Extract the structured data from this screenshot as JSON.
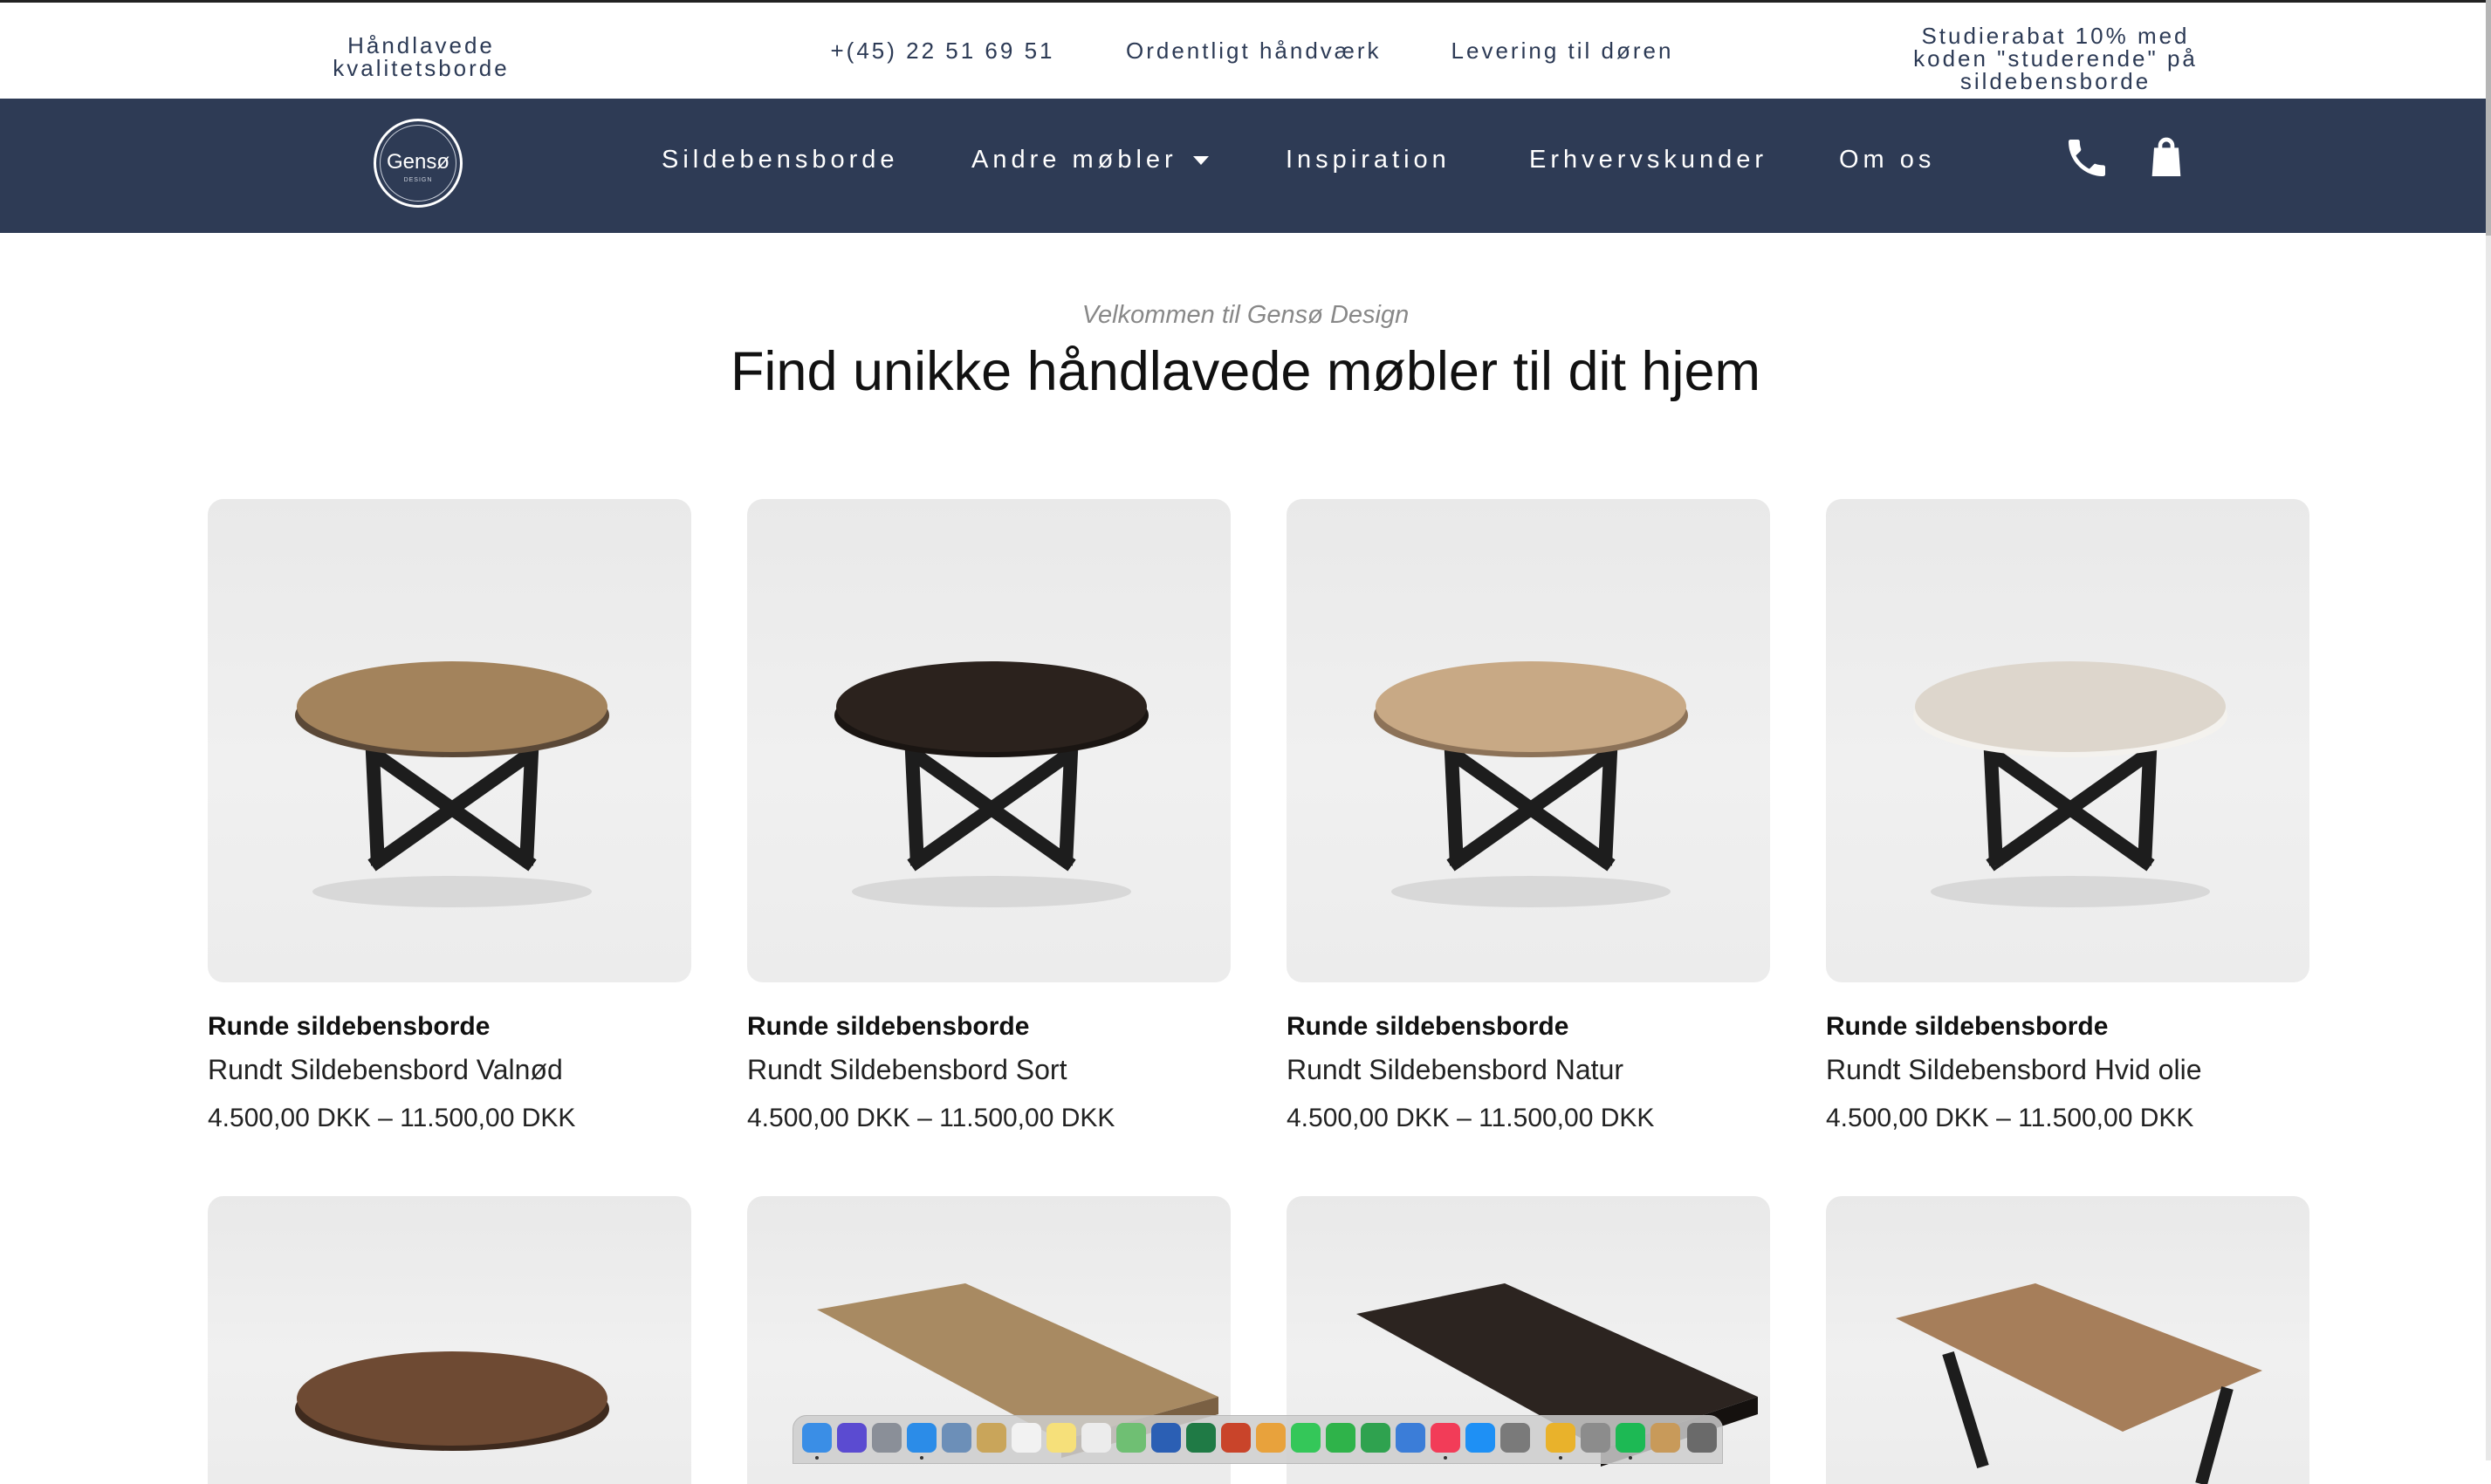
{
  "topbar": {
    "item1": "Håndlavede kvalitetsborde",
    "phone": "+(45) 22 51 69 51",
    "quality": "Ordentligt håndværk",
    "delivery": "Levering til døren",
    "student": "Studierabat 10% med koden \"studerende\" på sildebensborde"
  },
  "nav": {
    "logo_name": "Gensø",
    "logo_sub": "DESIGN",
    "items": [
      "Sildebensborde",
      "Andre møbler",
      "Inspiration",
      "Erhvervskunder",
      "Om os"
    ],
    "icons": [
      "phone-icon",
      "shopping-bag-icon"
    ]
  },
  "hero": {
    "eyebrow": "Velkommen til Gensø Design",
    "headline": "Find unikke håndlavede møbler til dit hjem"
  },
  "products": [
    {
      "category": "Runde sildebensborde",
      "title": "Rundt Sildebensbord Valnød",
      "price": "4.500,00 DKK – 11.500,00 DKK",
      "top_color": "#a3835c"
    },
    {
      "category": "Runde sildebensborde",
      "title": "Rundt Sildebensbord Sort",
      "price": "4.500,00 DKK – 11.500,00 DKK",
      "top_color": "#2b221d"
    },
    {
      "category": "Runde sildebensborde",
      "title": "Rundt Sildebensbord Natur",
      "price": "4.500,00 DKK – 11.500,00 DKK",
      "top_color": "#c8a985"
    },
    {
      "category": "Runde sildebensborde",
      "title": "Rundt Sildebensbord Hvid olie",
      "price": "4.500,00 DKK – 11.500,00 DKK",
      "top_color": "#ddd6cc"
    }
  ],
  "products_row2": [
    {
      "top_color": "#6e4a33"
    },
    {
      "top_color": "#a88a62"
    },
    {
      "top_color": "#2c2420"
    },
    {
      "top_color": "#a67e5a"
    }
  ],
  "colors": {
    "nav_bg": "#2e3b55",
    "topbar_text": "#2c3a55",
    "card_bg": "#ececec"
  }
}
